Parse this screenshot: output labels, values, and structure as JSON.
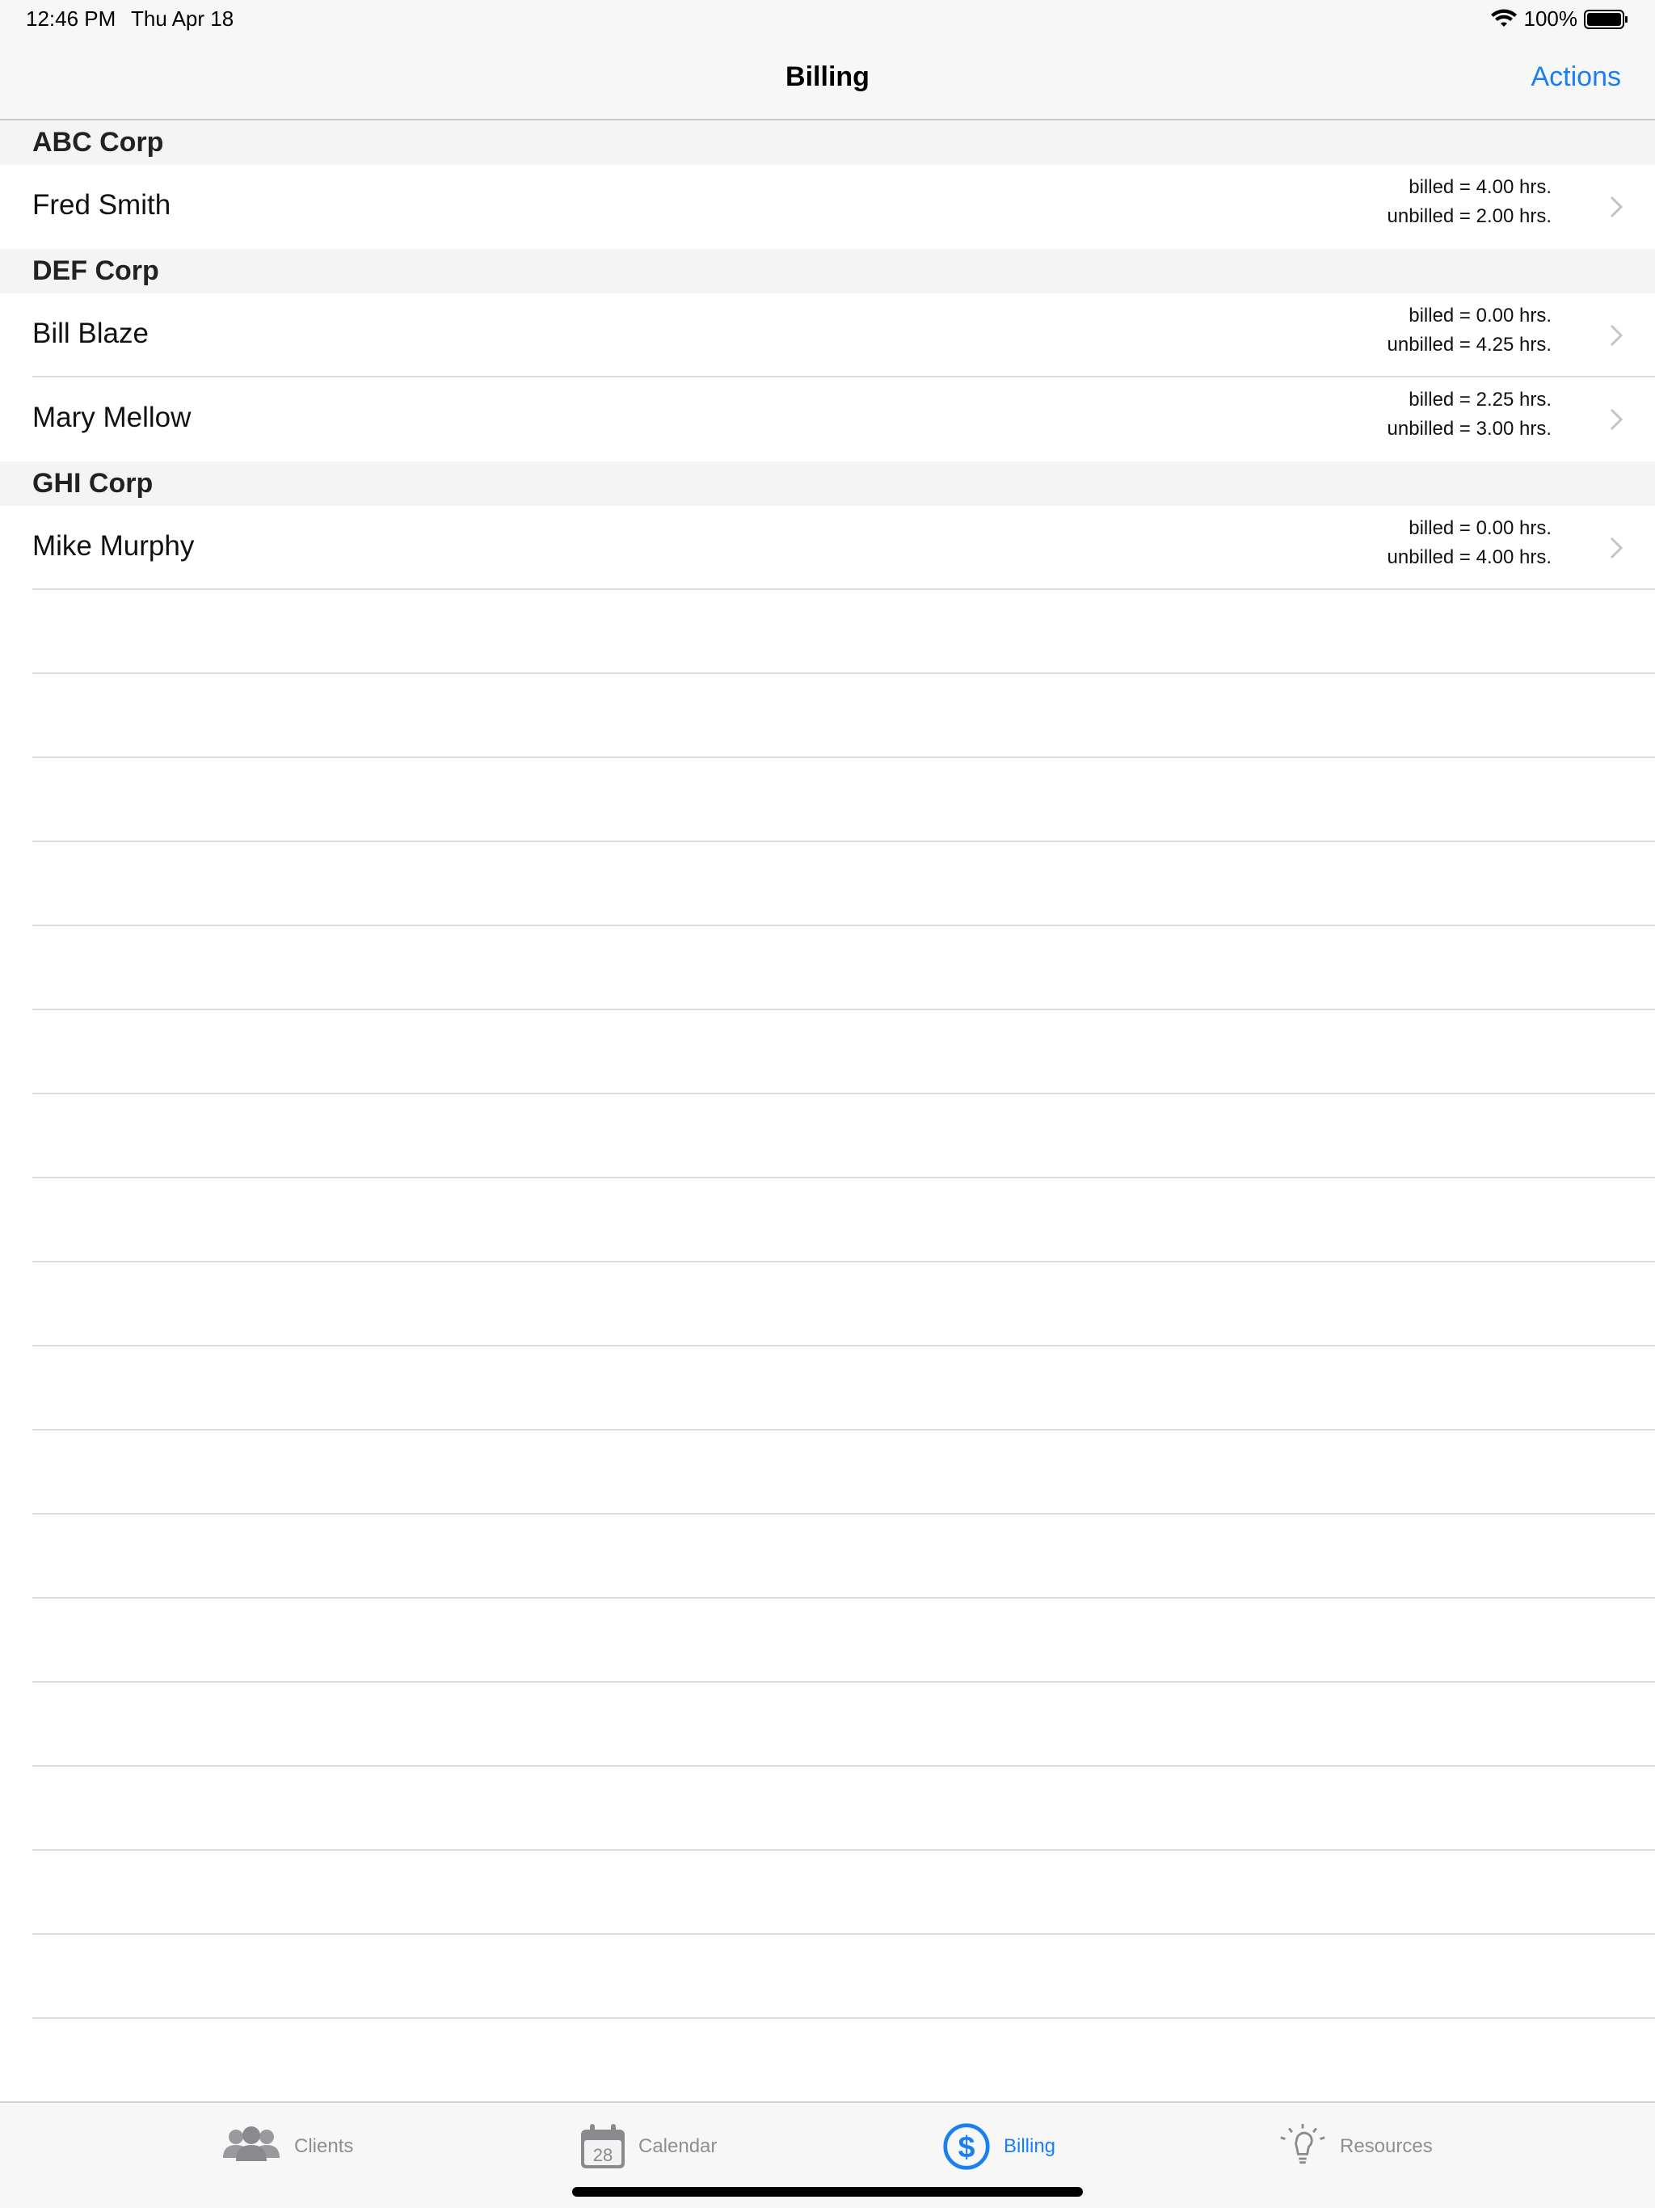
{
  "status_bar": {
    "time": "12:46 PM",
    "date": "Thu Apr 18",
    "battery": "100%"
  },
  "nav": {
    "title": "Billing",
    "actions_label": "Actions",
    "accent_color": "#1a7ff3"
  },
  "sections": [
    {
      "header": "ABC Corp",
      "rows": [
        {
          "name": "Fred Smith",
          "billed": "billed = 4.00 hrs.",
          "unbilled": "unbilled = 2.00 hrs."
        }
      ]
    },
    {
      "header": "DEF Corp",
      "rows": [
        {
          "name": "Bill Blaze",
          "billed": "billed = 0.00 hrs.",
          "unbilled": "unbilled = 4.25 hrs."
        },
        {
          "name": "Mary Mellow",
          "billed": "billed = 2.25 hrs.",
          "unbilled": "unbilled = 3.00 hrs."
        }
      ]
    },
    {
      "header": "GHI Corp",
      "rows": [
        {
          "name": "Mike Murphy",
          "billed": "billed = 0.00 hrs.",
          "unbilled": "unbilled = 4.00 hrs."
        }
      ]
    }
  ],
  "tabs": [
    {
      "label": "Clients",
      "icon": "clients-icon",
      "active": false
    },
    {
      "label": "Calendar",
      "icon": "calendar-icon",
      "calendar_day": "28",
      "active": false
    },
    {
      "label": "Billing",
      "icon": "billing-dollar-icon",
      "active": true
    },
    {
      "label": "Resources",
      "icon": "lightbulb-icon",
      "active": false
    }
  ]
}
